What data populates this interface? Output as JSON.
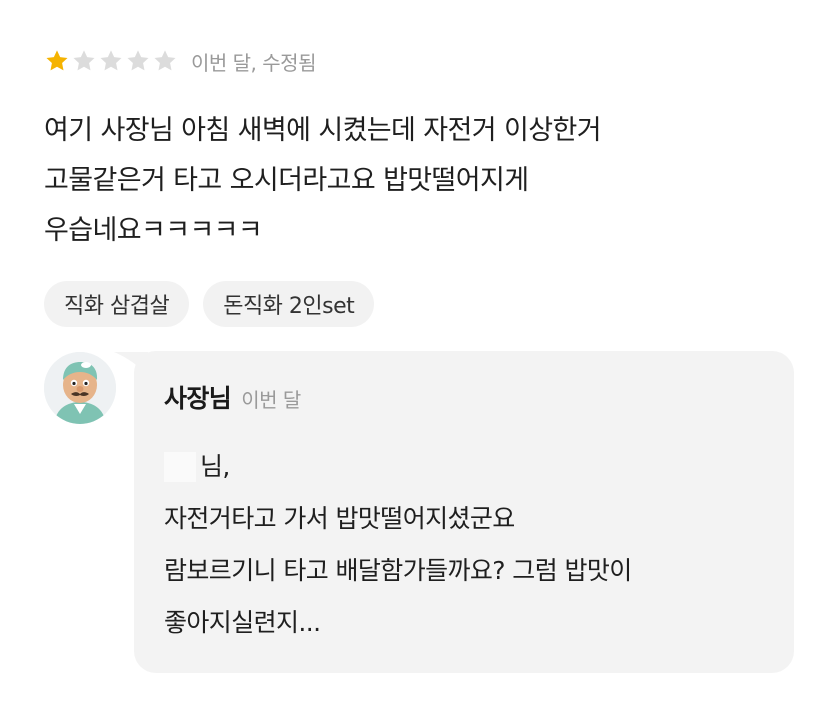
{
  "review": {
    "rating": 1,
    "max_rating": 5,
    "colors": {
      "star_filled": "#f5b301",
      "star_empty": "#dcdcdc"
    },
    "meta": "이번 달, 수정됨",
    "body_lines": [
      "여기 사장님 아침 새벽에 시켰는데 자전거 이상한거",
      "고물같은거 타고 오시더라고요 밥맛떨어지게",
      "우습네요ㅋㅋㅋㅋㅋ"
    ],
    "tags": [
      "직화 삼겹살",
      "돈직화 2인set"
    ]
  },
  "reply": {
    "avatar_icon": "cartoon-owner-avatar-icon",
    "owner_name": "사장님",
    "date": "이번 달",
    "greeting": "님,",
    "lines": [
      "자전거타고 가서 밥맛떨어지셨군요",
      "람보르기니 타고 배달함가들까요? 그럼 밥맛이",
      "좋아지실련지..."
    ],
    "bubble_color": "#f3f3f3"
  }
}
